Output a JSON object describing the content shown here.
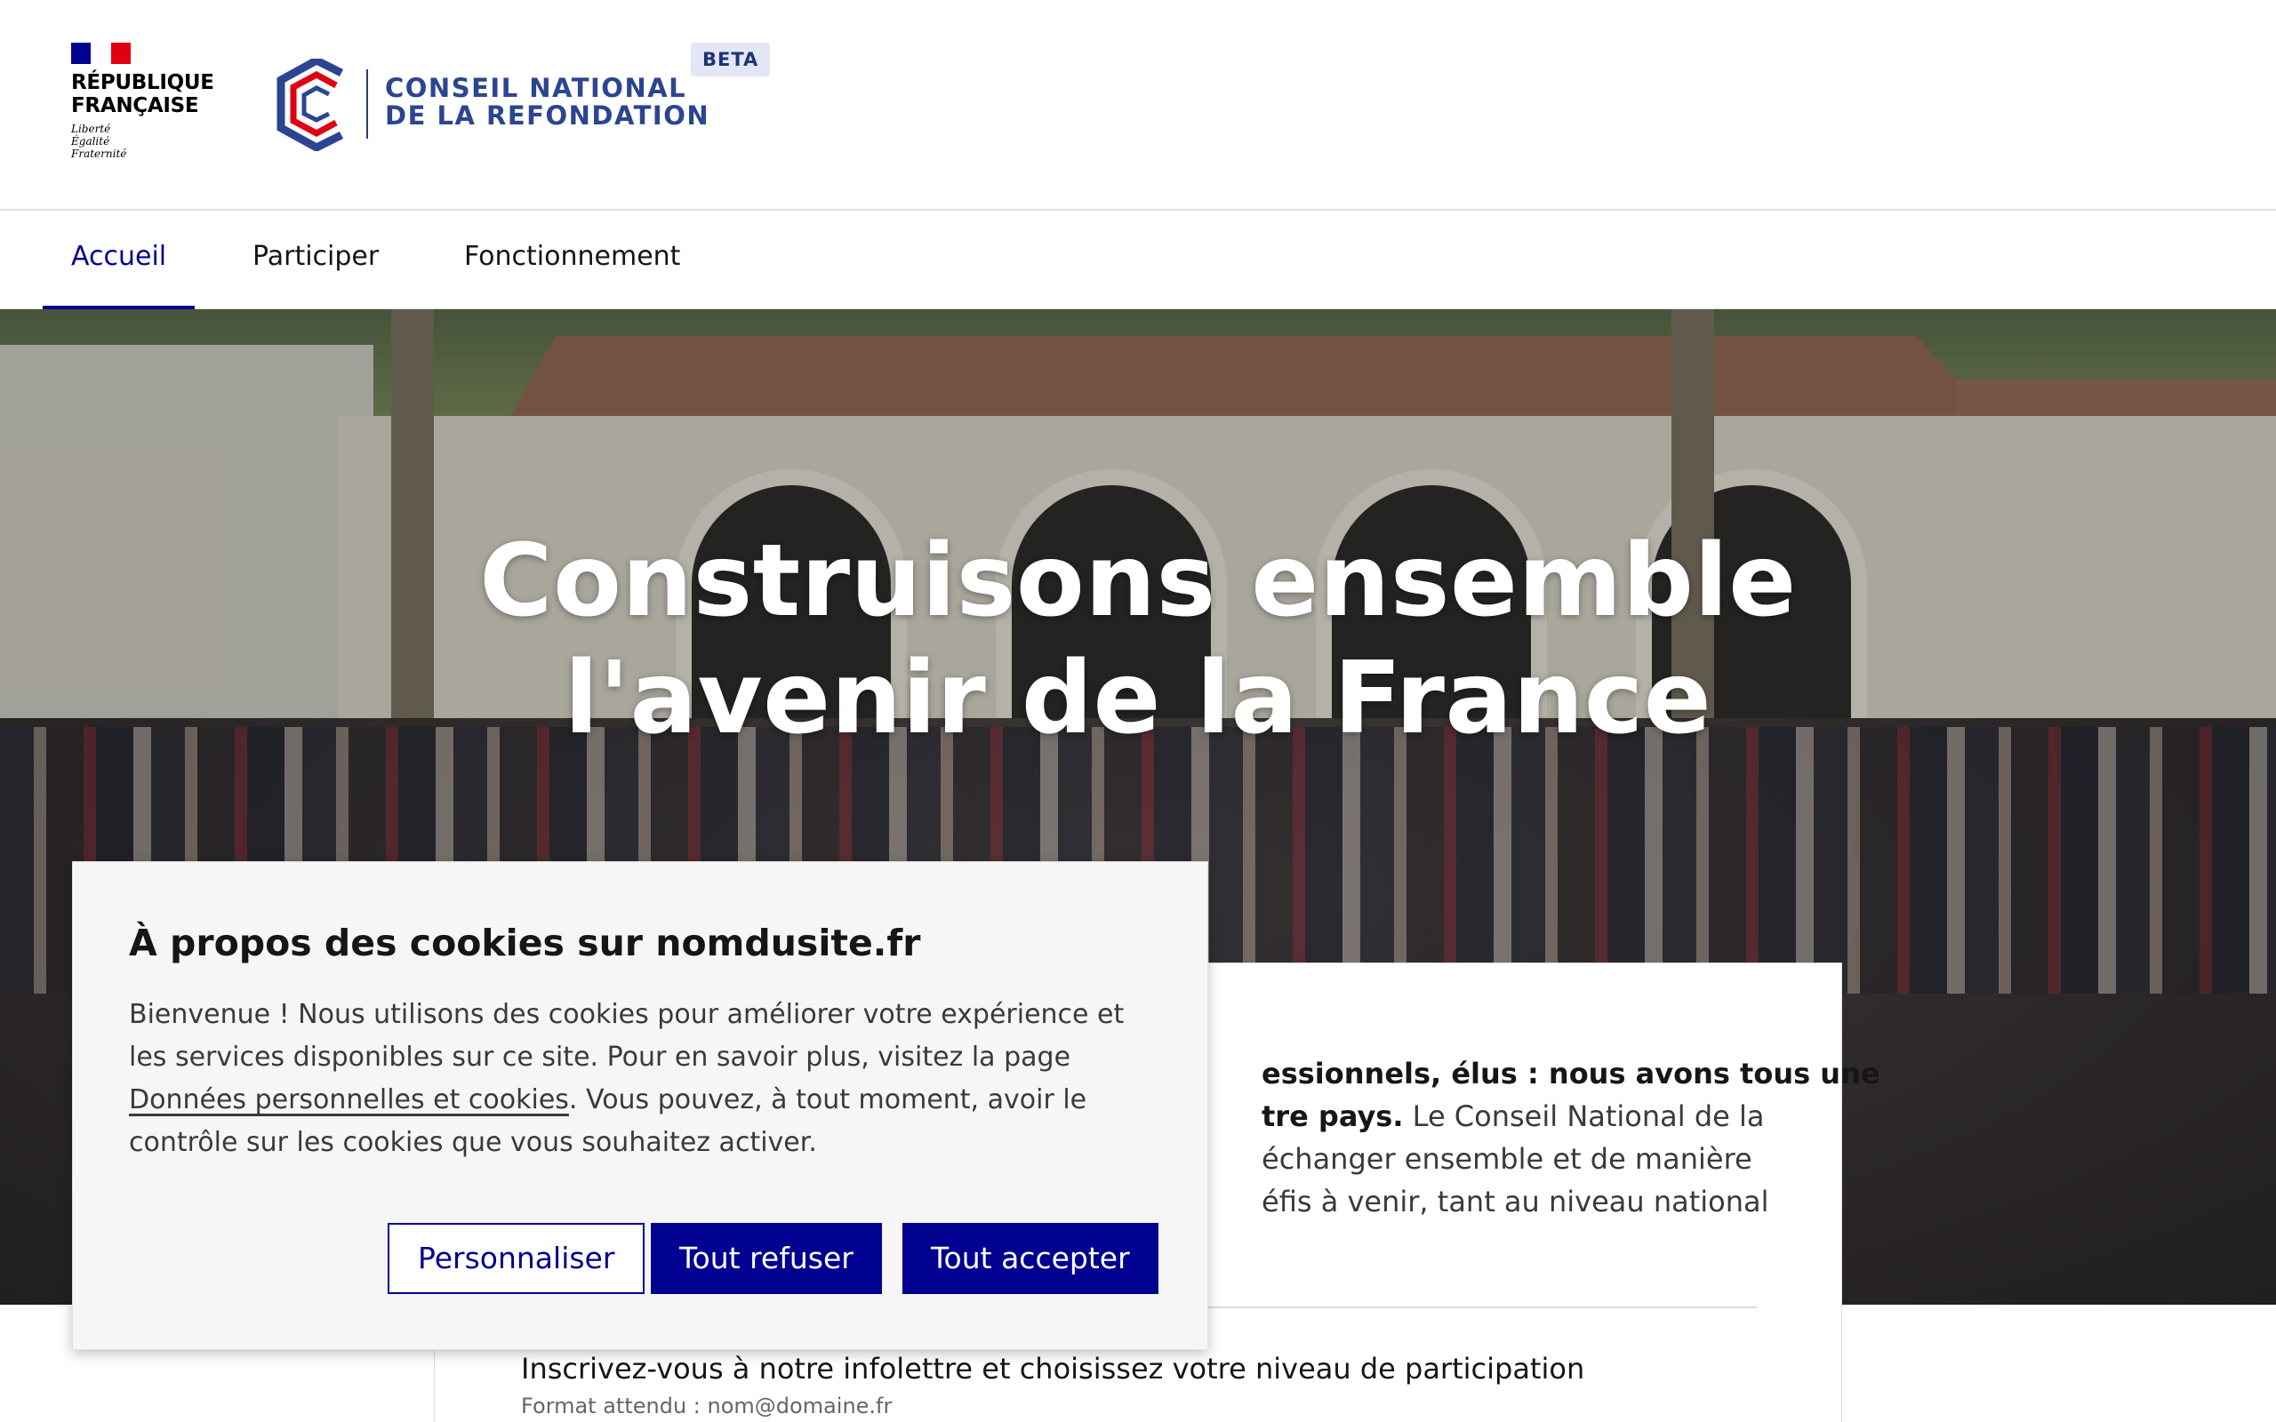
{
  "header": {
    "rf_logo": {
      "title_line1": "RÉPUBLIQUE",
      "title_line2": "FRANÇAISE",
      "motto": [
        "Liberté",
        "Égalité",
        "Fraternité"
      ]
    },
    "site_name_line1": "CONSEIL NATIONAL",
    "site_name_line2": "DE LA REFONDATION",
    "beta_badge": "BETA"
  },
  "nav": {
    "items": [
      {
        "label": "Accueil",
        "active": true
      },
      {
        "label": "Participer",
        "active": false
      },
      {
        "label": "Fonctionnement",
        "active": false
      }
    ]
  },
  "hero": {
    "title_line1": "Construisons ensemble",
    "title_line2": "l'avenir de la France"
  },
  "content": {
    "intro_bold_1": "essionnels, élus : nous avons tous une",
    "intro_bold_2": "tre pays.",
    "intro_rest_1": " Le Conseil National de la",
    "intro_line_3": "échanger ensemble et de manière",
    "intro_line_4": "éfis à venir, tant au niveau national",
    "newsletter_label": "Inscrivez-vous à notre infolettre et choisissez votre niveau de participation",
    "newsletter_hint": "Format attendu : nom@domaine.fr"
  },
  "cookie_modal": {
    "title": "À propos des cookies sur nomdusite.fr",
    "body_part1": "Bienvenue ! Nous utilisons des cookies pour améliorer votre expérience et les services disponibles sur ce site. Pour en savoir plus, visitez la page ",
    "body_link": "Données personnelles et cookies",
    "body_part2": ". Vous pouvez, à tout moment, avoir le contrôle sur les cookies que vous souhaitez activer.",
    "btn_customize": "Personnaliser",
    "btn_refuse_all": "Tout refuser",
    "btn_accept_all": "Tout accepter"
  },
  "colors": {
    "primary_blue": "#000091",
    "brand_navy": "#2c4591",
    "accent_red": "#e1000f",
    "beta_badge_bg": "#e3e7f5",
    "modal_bg": "#f6f6f6"
  }
}
